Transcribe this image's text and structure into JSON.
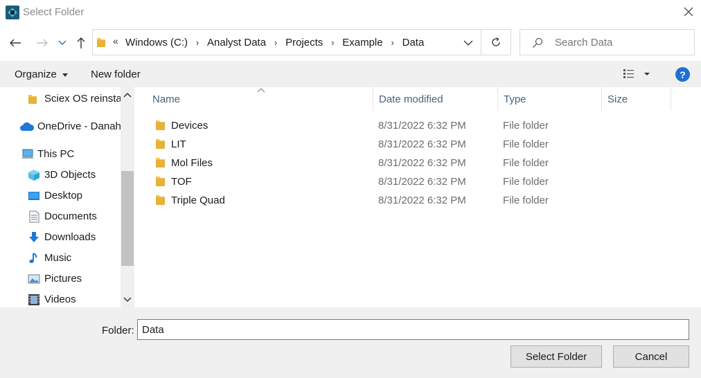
{
  "window": {
    "title": "Select Folder"
  },
  "address": {
    "overflow_marker": "«",
    "crumbs": [
      "Windows (C:)",
      "Analyst Data",
      "Projects",
      "Example",
      "Data"
    ]
  },
  "search": {
    "placeholder": "Search Data"
  },
  "toolbar": {
    "organize_label": "Organize",
    "new_folder_label": "New folder"
  },
  "nav": {
    "items": [
      {
        "label": "Sciex OS reinstal",
        "icon": "folder-icon"
      },
      {
        "label": "OneDrive - Danah",
        "icon": "onedrive-icon"
      },
      {
        "label": "This PC",
        "icon": "computer-icon"
      },
      {
        "label": "3D Objects",
        "icon": "cube-icon"
      },
      {
        "label": "Desktop",
        "icon": "desktop-icon"
      },
      {
        "label": "Documents",
        "icon": "document-icon"
      },
      {
        "label": "Downloads",
        "icon": "download-icon"
      },
      {
        "label": "Music",
        "icon": "music-icon"
      },
      {
        "label": "Pictures",
        "icon": "pictures-icon"
      },
      {
        "label": "Videos",
        "icon": "videos-icon"
      }
    ]
  },
  "columns": {
    "name": "Name",
    "date": "Date modified",
    "type": "Type",
    "size": "Size"
  },
  "files": [
    {
      "name": "Devices",
      "date": "8/31/2022 6:32 PM",
      "type": "File folder"
    },
    {
      "name": "LIT",
      "date": "8/31/2022 6:32 PM",
      "type": "File folder"
    },
    {
      "name": "Mol Files",
      "date": "8/31/2022 6:32 PM",
      "type": "File folder"
    },
    {
      "name": "TOF",
      "date": "8/31/2022 6:32 PM",
      "type": "File folder"
    },
    {
      "name": "Triple Quad",
      "date": "8/31/2022 6:32 PM",
      "type": "File folder"
    }
  ],
  "footer": {
    "folder_label": "Folder:",
    "folder_value": "Data",
    "select_label": "Select Folder",
    "cancel_label": "Cancel"
  },
  "colors": {
    "accent": "#1f6fd1",
    "folder": "#f5c542",
    "header_text": "#4c607a"
  }
}
